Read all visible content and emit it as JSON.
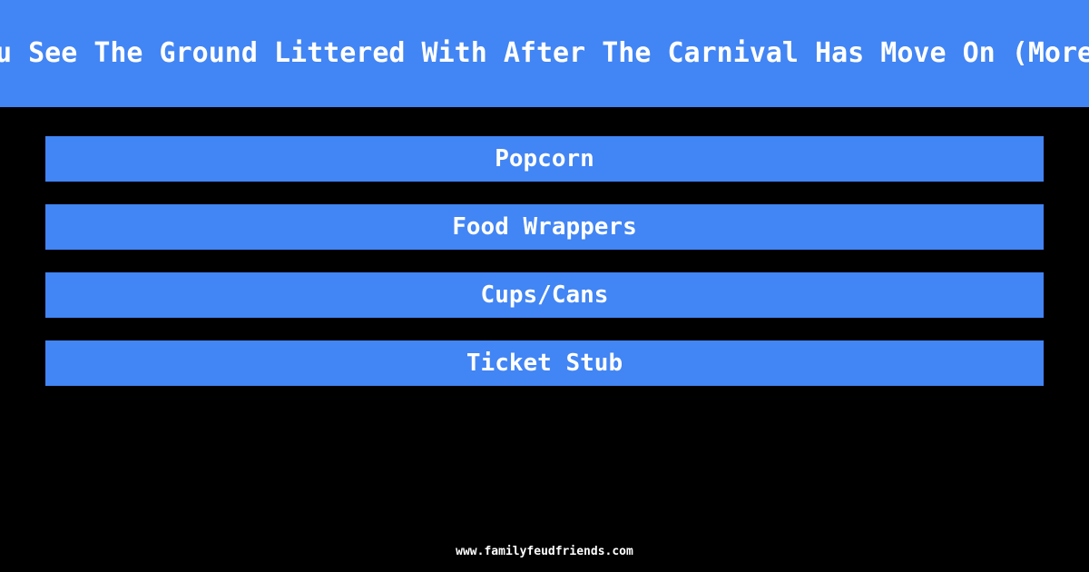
{
  "header": {
    "question": "What Do You See The Ground Littered With After The Carnival Has Move On (More Specific)",
    "band_color": "#4285f4",
    "text_color": "#ffffff"
  },
  "answers": {
    "items": [
      {
        "label": "Popcorn"
      },
      {
        "label": "Food Wrappers"
      },
      {
        "label": "Cups/Cans"
      },
      {
        "label": "Ticket Stub"
      }
    ],
    "bar_color": "#4285f4",
    "text_color": "#ffffff"
  },
  "footer": {
    "site": "www.familyfeudfriends.com"
  },
  "background_color": "#000000"
}
